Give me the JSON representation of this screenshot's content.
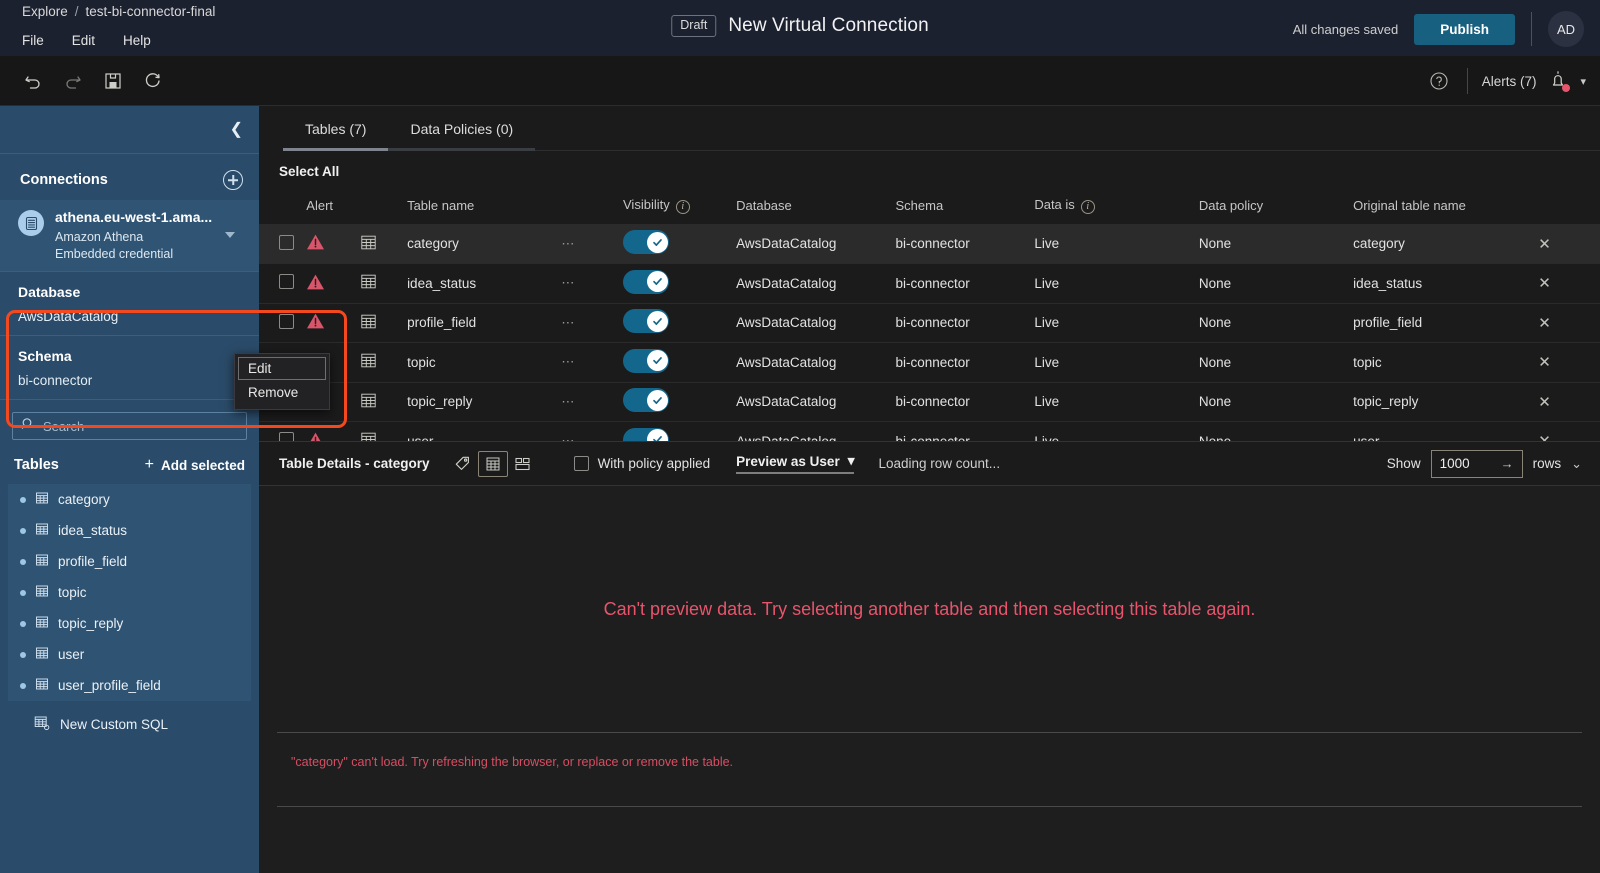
{
  "topbar": {
    "breadcrumb": {
      "root": "Explore",
      "separator": "/",
      "current": "test-bi-connector-final"
    },
    "menus": [
      {
        "label": "File",
        "icon": "file-menu"
      },
      {
        "label": "Edit",
        "icon": "edit-menu"
      },
      {
        "label": "Help",
        "icon": "help-menu"
      }
    ],
    "draft_badge": "Draft",
    "doc_title": "New Virtual Connection",
    "saved_status": "All changes saved",
    "publish_label": "Publish",
    "avatar_initials": "AD",
    "accent_color": "#17607f",
    "bar_color": "#1c2130"
  },
  "toolbar": {
    "undo_icon": "undo-icon",
    "redo_icon": "redo-icon",
    "save_icon": "save-icon",
    "refresh_icon": "refresh-icon",
    "help_icon": "help-circle-icon",
    "alerts_label": "Alerts (7)",
    "bell_icon": "bell-icon",
    "alert_dot_color": "#e8546b",
    "caret_label": "▾"
  },
  "sidebar": {
    "collapse_icon": "chevron-left-icon",
    "background_color": "#2a4b69",
    "connections": {
      "title": "Connections",
      "add_icon": "plus-circle-icon",
      "items": [
        {
          "name": "athena.eu-west-1.ama...",
          "type": "Amazon Athena",
          "credential": "Embedded credential",
          "icon": "database-connection-icon"
        }
      ]
    },
    "database": {
      "label": "Database",
      "value": "AwsDataCatalog"
    },
    "schema": {
      "label": "Schema",
      "value": "bi-connector"
    },
    "search": {
      "placeholder": "Search",
      "value": "",
      "icon": "search-icon"
    },
    "tables_header": {
      "title": "Tables",
      "add_selected": "Add selected",
      "plus": "+"
    },
    "tables": [
      {
        "label": "category",
        "icon": "table-icon"
      },
      {
        "label": "idea_status",
        "icon": "table-icon"
      },
      {
        "label": "profile_field",
        "icon": "table-icon"
      },
      {
        "label": "topic",
        "icon": "table-icon"
      },
      {
        "label": "topic_reply",
        "icon": "table-icon"
      },
      {
        "label": "user",
        "icon": "table-icon"
      },
      {
        "label": "user_profile_field",
        "icon": "table-icon"
      }
    ],
    "custom_sql": {
      "label": "New Custom SQL",
      "icon": "custom-sql-icon"
    }
  },
  "context_menu": {
    "items": [
      {
        "label": "Edit",
        "focused": true
      },
      {
        "label": "Remove",
        "focused": false
      }
    ]
  },
  "annotation": {
    "color": "#f4481e"
  },
  "main": {
    "tabs": [
      {
        "label": "Tables (7)",
        "active": true
      },
      {
        "label": "Data Policies (0)",
        "active": false
      }
    ],
    "select_all": "Select All",
    "columns": [
      "",
      "Alert",
      "",
      "Table name",
      "",
      "Visibility",
      "Database",
      "Schema",
      "Data is",
      "Data policy",
      "Original table name",
      ""
    ],
    "column_headers": {
      "alert": "Alert",
      "table_name": "Table name",
      "visibility": "Visibility",
      "database": "Database",
      "schema": "Schema",
      "data_is": "Data is",
      "data_policy": "Data policy",
      "original_table_name": "Original table name"
    },
    "rows": [
      {
        "alert": true,
        "name": "category",
        "visible": true,
        "database": "AwsDataCatalog",
        "schema": "bi-connector",
        "data_is": "Live",
        "data_policy": "None",
        "original": "category",
        "selected": true
      },
      {
        "alert": true,
        "name": "idea_status",
        "visible": true,
        "database": "AwsDataCatalog",
        "schema": "bi-connector",
        "data_is": "Live",
        "data_policy": "None",
        "original": "idea_status",
        "selected": false
      },
      {
        "alert": true,
        "name": "profile_field",
        "visible": true,
        "database": "AwsDataCatalog",
        "schema": "bi-connector",
        "data_is": "Live",
        "data_policy": "None",
        "original": "profile_field",
        "selected": false
      },
      {
        "alert": true,
        "name": "topic",
        "visible": true,
        "database": "AwsDataCatalog",
        "schema": "bi-connector",
        "data_is": "Live",
        "data_policy": "None",
        "original": "topic",
        "selected": false
      },
      {
        "alert": true,
        "name": "topic_reply",
        "visible": true,
        "database": "AwsDataCatalog",
        "schema": "bi-connector",
        "data_is": "Live",
        "data_policy": "None",
        "original": "topic_reply",
        "selected": false
      },
      {
        "alert": true,
        "name": "user",
        "visible": true,
        "database": "AwsDataCatalog",
        "schema": "bi-connector",
        "data_is": "Live",
        "data_policy": "None",
        "original": "user",
        "selected": false
      }
    ],
    "row_dots": "⋯",
    "row_close": "✕",
    "toggle_on_color": "#14678c"
  },
  "details": {
    "title": "Table Details - category",
    "tag_icon": "tag-icon",
    "grid_icon": "grid-view-icon",
    "card_icon": "card-view-icon",
    "with_policy_label": "With policy applied",
    "with_policy_checked": false,
    "preview_as": "Preview as User",
    "preview_caret": "▾",
    "loading_text": "Loading row count...",
    "show_label": "Show",
    "rows_value": "1000",
    "rows_arrow": "→",
    "rows_label": "rows",
    "collapse_caret": "⌄"
  },
  "preview": {
    "message": "Can't preview data. Try selecting another table and then selecting this table again.",
    "error": "\"category\" can't load. Try refreshing the browser, or replace or remove the table.",
    "error_color": "#e8546b"
  }
}
